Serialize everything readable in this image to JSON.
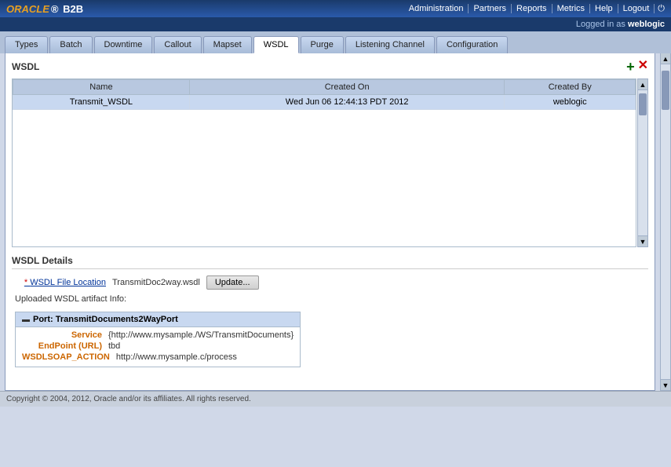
{
  "header": {
    "logo_oracle": "ORACLE",
    "logo_b2b": "B2B",
    "nav_items": [
      "Administration",
      "Partners",
      "Reports",
      "Metrics",
      "Help",
      "Logout"
    ],
    "logged_in_label": "Logged in as",
    "logged_in_user": "weblogic"
  },
  "tabs": {
    "items": [
      "Types",
      "Batch",
      "Downtime",
      "Callout",
      "Mapset",
      "WSDL",
      "Purge",
      "Listening Channel",
      "Configuration"
    ],
    "active": "WSDL"
  },
  "wsdl_section": {
    "title": "WSDL",
    "add_tooltip": "+",
    "delete_tooltip": "✕",
    "table": {
      "columns": [
        "Name",
        "Created On",
        "Created By"
      ],
      "rows": [
        {
          "name": "Transmit_WSDL",
          "created_on": "Wed Jun 06 12:44:13 PDT 2012",
          "created_by": "weblogic"
        }
      ]
    }
  },
  "wsdl_details": {
    "title": "WSDL Details",
    "file_location_label": "WSDL File Location",
    "file_location_value": "TransmitDoc2way.wsdl",
    "update_button": "Update...",
    "uploaded_info_label": "Uploaded WSDL artifact Info:",
    "port": {
      "name": "TransmitDocuments2WayPort",
      "service_label": "Service",
      "service_value": "{http://www.mysample./WS/TransmitDocuments}",
      "endpoint_label": "EndPoint (URL)",
      "endpoint_value": "tbd",
      "soap_action_label": "WSDLSOAP_ACTION",
      "soap_action_value": "http://www.mysample.c/process"
    }
  },
  "footer": {
    "text": "Copyright © 2004, 2012, Oracle and/or its affiliates. All rights reserved."
  }
}
